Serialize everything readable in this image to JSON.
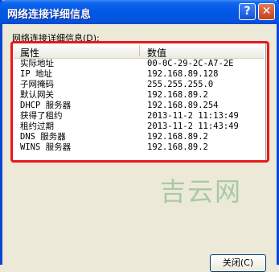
{
  "window": {
    "title": "网络连接详细信息",
    "help_glyph": "?",
    "close_glyph": "✕"
  },
  "group_label": "网络连接详细信息(D):",
  "table": {
    "columns": [
      "属性",
      "数值"
    ],
    "rows": [
      {
        "property": "实际地址",
        "value": "00-0C-29-2C-A7-2E"
      },
      {
        "property": "IP 地址",
        "value": "192.168.89.128"
      },
      {
        "property": "子网掩码",
        "value": "255.255.255.0"
      },
      {
        "property": "默认网关",
        "value": "192.168.89.2"
      },
      {
        "property": "DHCP 服务器",
        "value": "192.168.89.254"
      },
      {
        "property": "获得了租约",
        "value": "2013-11-2 11:13:49"
      },
      {
        "property": "租约过期",
        "value": "2013-11-2 11:43:49"
      },
      {
        "property": "DNS 服务器",
        "value": "192.168.89.2"
      },
      {
        "property": "WINS 服务器",
        "value": "192.168.89.2"
      }
    ]
  },
  "watermark": "吉云网",
  "close_button_label": "关闭(C)",
  "colors": {
    "titlebar": "#0058e6",
    "highlight_border": "#e8181c",
    "background": "#ece9d8"
  }
}
